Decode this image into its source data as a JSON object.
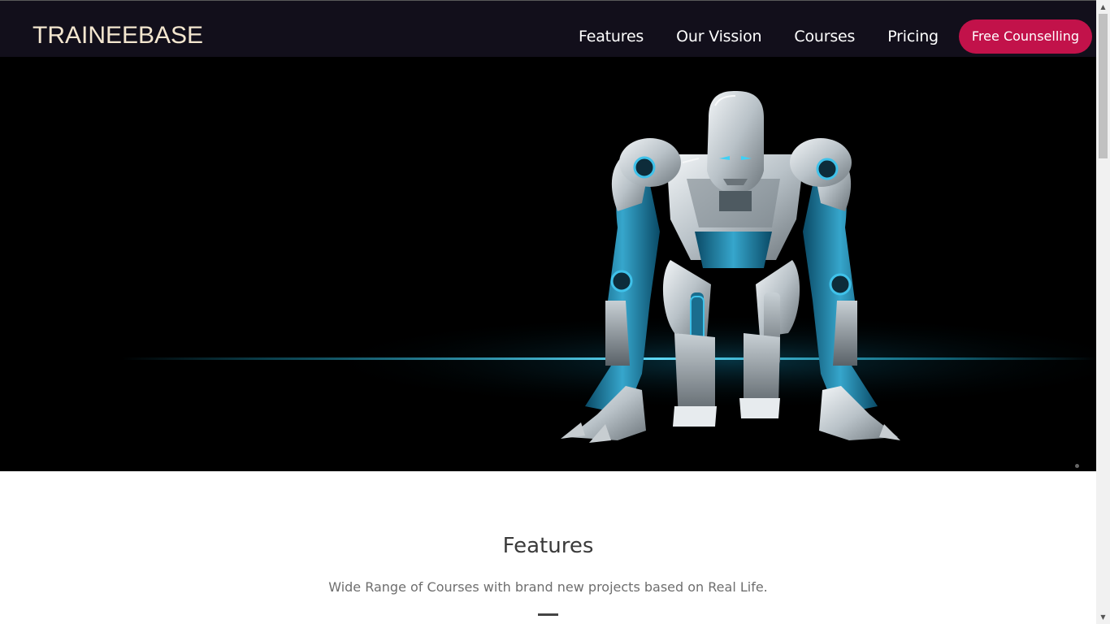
{
  "navbar": {
    "brand": "TRAINEEBASE",
    "links": [
      "Features",
      "Our Vission",
      "Courses",
      "Pricing"
    ],
    "cta_label": "Free Counselling"
  },
  "hero": {
    "image": "robot-sprinter-start-position",
    "slide_indicator": "carousel-dot"
  },
  "features": {
    "title": "Features",
    "subtitle": "Wide Range of Courses with brand new projects based on Real Life."
  },
  "colors": {
    "navbar_bg": "#120f1b",
    "brand_text": "#f3e6cf",
    "accent": "#c2124a",
    "hero_bg": "#000000",
    "glow": "#1fb4d8"
  },
  "icons": {
    "scroll_up": "triangle-up-icon",
    "scroll_down": "triangle-down-icon"
  }
}
